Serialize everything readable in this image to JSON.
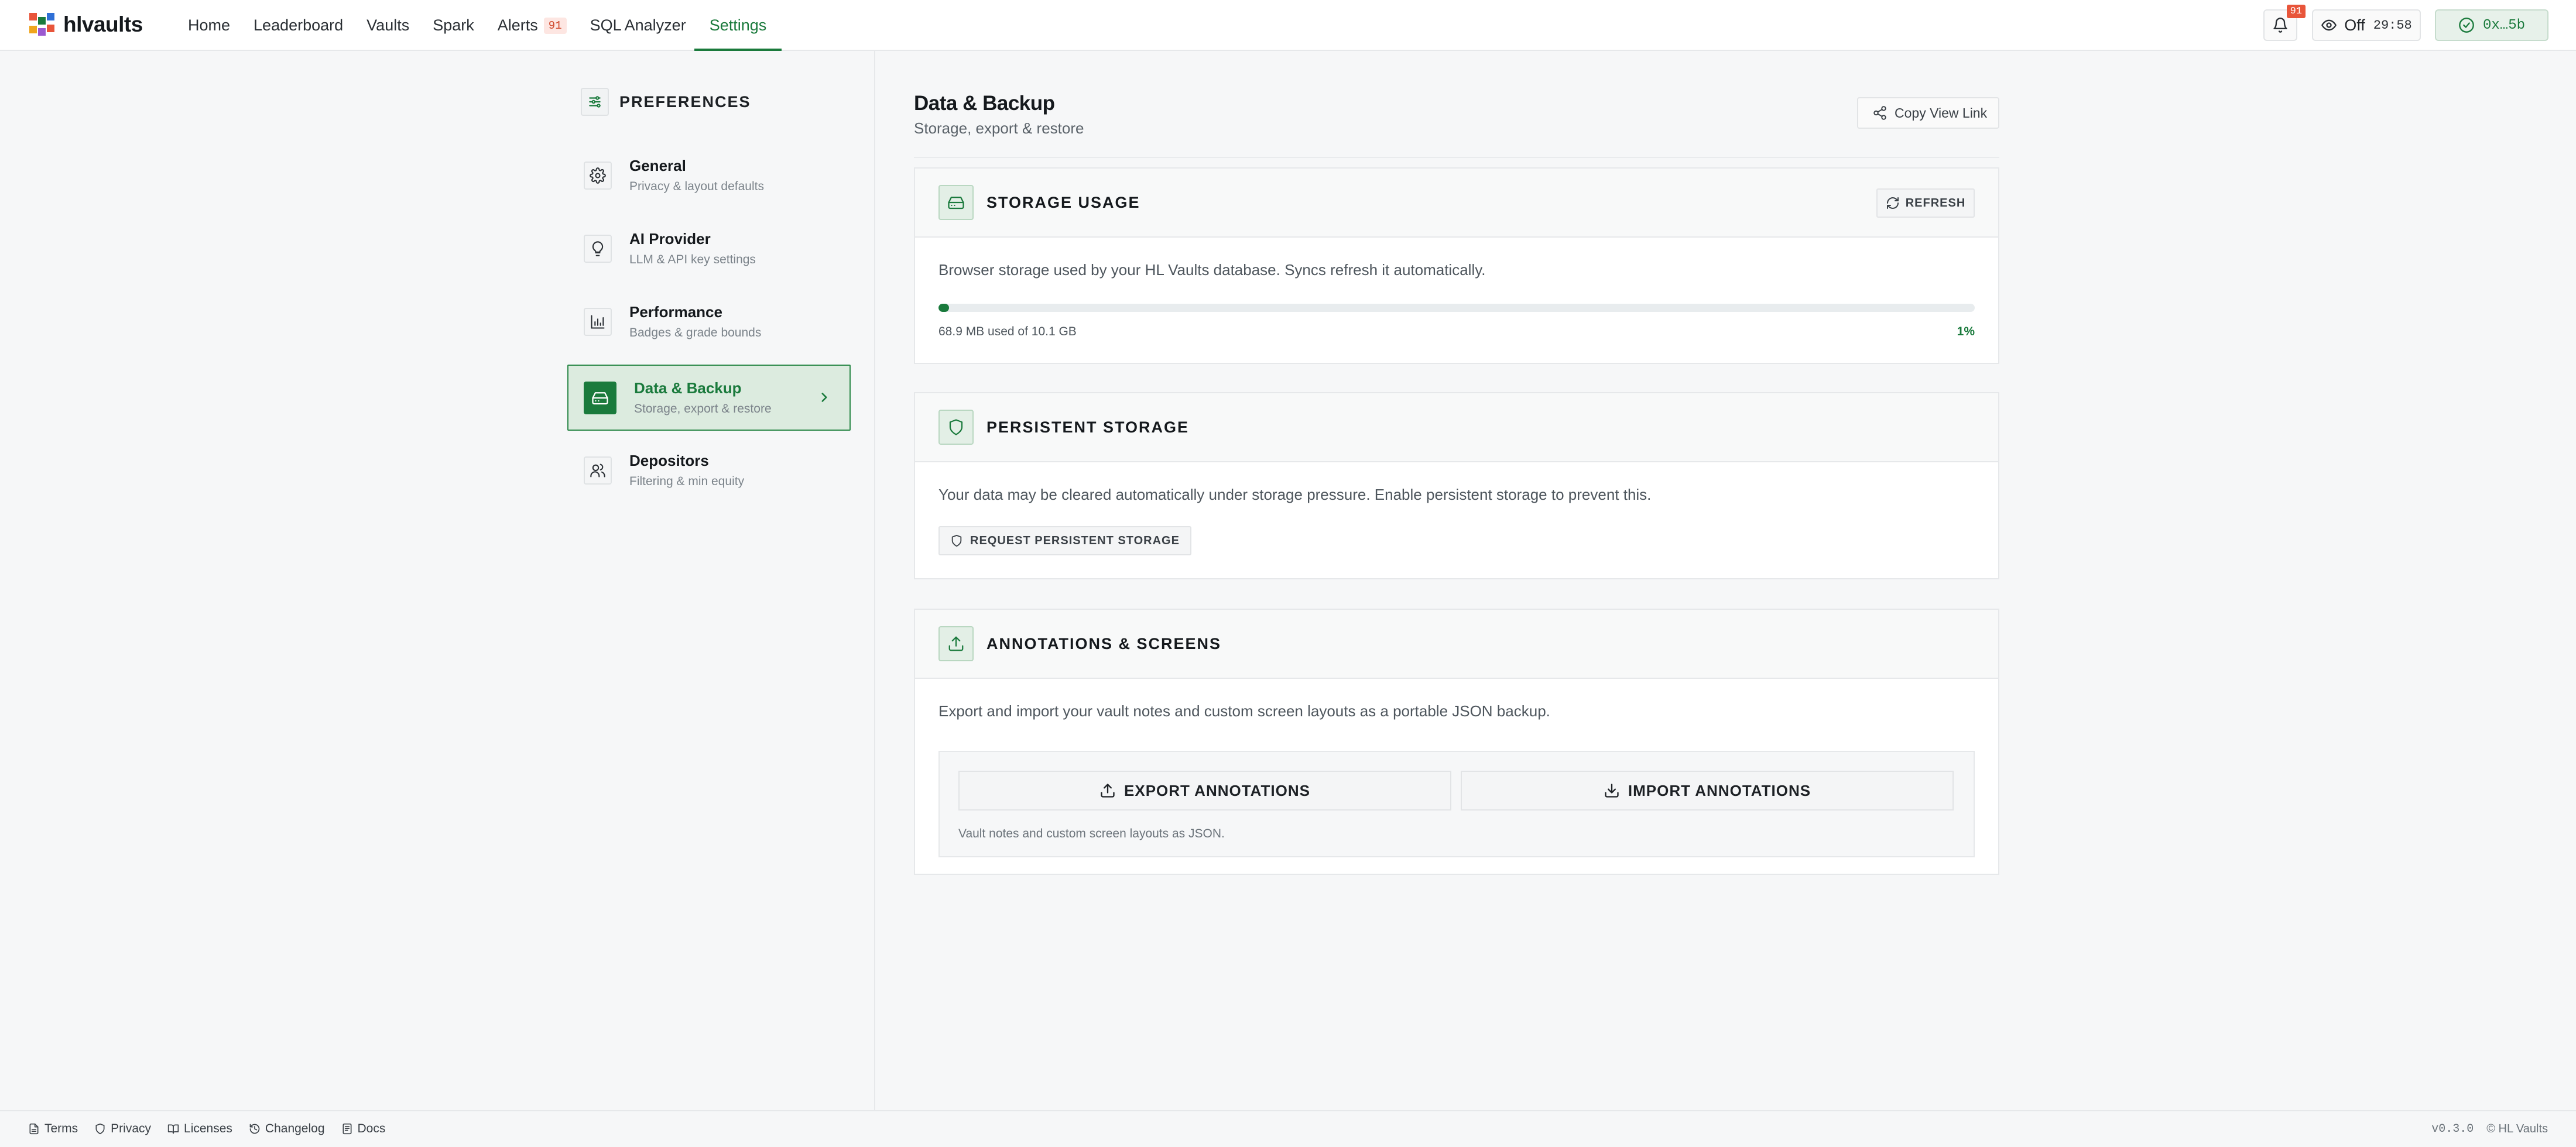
{
  "app": {
    "name": "hlvaults"
  },
  "nav": {
    "items": [
      "Home",
      "Leaderboard",
      "Vaults",
      "Spark",
      "Alerts",
      "SQL Analyzer",
      "Settings"
    ],
    "alerts_badge": "91",
    "active": "Settings"
  },
  "topbar": {
    "bell_badge": "91",
    "mode_label": "Off",
    "timer": "29:58",
    "wallet": "0x…5b"
  },
  "sidebar": {
    "title": "PREFERENCES",
    "items": [
      {
        "title": "General",
        "subtitle": "Privacy & layout defaults",
        "icon": "gear-icon"
      },
      {
        "title": "AI Provider",
        "subtitle": "LLM & API key settings",
        "icon": "lightbulb-icon"
      },
      {
        "title": "Performance",
        "subtitle": "Badges & grade bounds",
        "icon": "bar-chart-icon"
      },
      {
        "title": "Data & Backup",
        "subtitle": "Storage, export & restore",
        "icon": "hard-drive-icon",
        "active": true
      },
      {
        "title": "Depositors",
        "subtitle": "Filtering & min equity",
        "icon": "users-icon"
      }
    ]
  },
  "page": {
    "title": "Data & Backup",
    "subtitle": "Storage, export & restore",
    "copy_link": "Copy View Link"
  },
  "storage": {
    "title": "STORAGE USAGE",
    "refresh": "REFRESH",
    "description": "Browser storage used by your HL Vaults database. Syncs refresh it automatically.",
    "used": "68.9 MB used of 10.1 GB",
    "percent": "1%",
    "fraction": 0.01
  },
  "persistent": {
    "title": "PERSISTENT STORAGE",
    "description": "Your data may be cleared automatically under storage pressure. Enable persistent storage to prevent this.",
    "button": "REQUEST PERSISTENT STORAGE"
  },
  "annotations": {
    "title": "ANNOTATIONS & SCREENS",
    "description": "Export and import your vault notes and custom screen layouts as a portable JSON backup.",
    "export": "EXPORT ANNOTATIONS",
    "import": "IMPORT ANNOTATIONS",
    "note": "Vault notes and custom screen layouts as JSON."
  },
  "footer": {
    "links": [
      "Terms",
      "Privacy",
      "Licenses",
      "Changelog",
      "Docs"
    ],
    "version": "v0.3.0",
    "copyright": "© HL Vaults"
  },
  "colors": {
    "accent": "#1a7a3c",
    "badge": "#e8553a"
  }
}
